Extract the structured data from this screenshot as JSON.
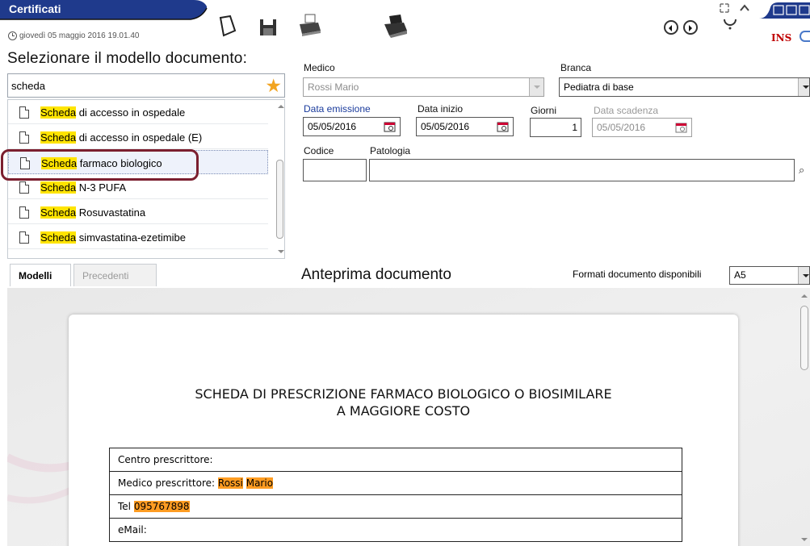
{
  "window": {
    "title": "Certificati",
    "datetime": "giovedì 05 maggio 2016 19.01.40",
    "ins_indicator": "INS"
  },
  "colors": {
    "title_tab": "#1f3a8c",
    "highlight_yellow": "#ffe400",
    "highlight_orange": "#ff9c22",
    "selection_ring": "#7b1f2f"
  },
  "toolbar": {
    "icons": [
      "eraser-icon",
      "save-icon",
      "print-icon",
      "print-preview-icon",
      "nav-prev-icon",
      "nav-next-icon",
      "help-icon"
    ]
  },
  "left": {
    "heading": "Selezionare il modello documento:",
    "search_value": "scheda",
    "items": [
      {
        "match": "Scheda",
        "rest": " di accesso in ospedale"
      },
      {
        "match": "Scheda",
        "rest": " di accesso in ospedale (E)"
      },
      {
        "match": "Scheda",
        "rest": " farmaco biologico"
      },
      {
        "match": "Scheda",
        "rest": " N-3 PUFA"
      },
      {
        "match": "Scheda",
        "rest": " Rosuvastatina"
      },
      {
        "match": "Scheda",
        "rest": " simvastatina-ezetimibe"
      }
    ],
    "selected_index": 2,
    "tabs": {
      "active": "Modelli",
      "inactive": "Precedenti"
    }
  },
  "form": {
    "medico_label": "Medico",
    "medico_value": "Rossi Mario",
    "branca_label": "Branca",
    "branca_value": "Pediatra di base",
    "data_emissione_label": "Data emissione",
    "data_emissione_value": "05/05/2016",
    "data_inizio_label": "Data inizio",
    "data_inizio_value": "05/05/2016",
    "giorni_label": "Giorni",
    "giorni_value": "1",
    "data_scadenza_label": "Data scadenza",
    "data_scadenza_value": "05/05/2016",
    "codice_label": "Codice",
    "codice_value": "",
    "patologia_label": "Patologia",
    "patologia_value": ""
  },
  "preview": {
    "title": "Anteprima documento",
    "formats_label": "Formati documento disponibili",
    "format_value": "A5",
    "doc_title_line1": "SCHEDA DI PRESCRIZIONE FARMACO BIOLOGICO O BIOSIMILARE",
    "doc_title_line2": "A MAGGIORE COSTO",
    "row_centro": "Centro prescrittore:",
    "row_medico_label": "Medico prescrittore:",
    "row_medico_cognome": "Rossi",
    "row_medico_nome": "Mario",
    "row_tel_label": "Tel",
    "row_tel_value": "095767898",
    "row_email": "eMail:"
  }
}
